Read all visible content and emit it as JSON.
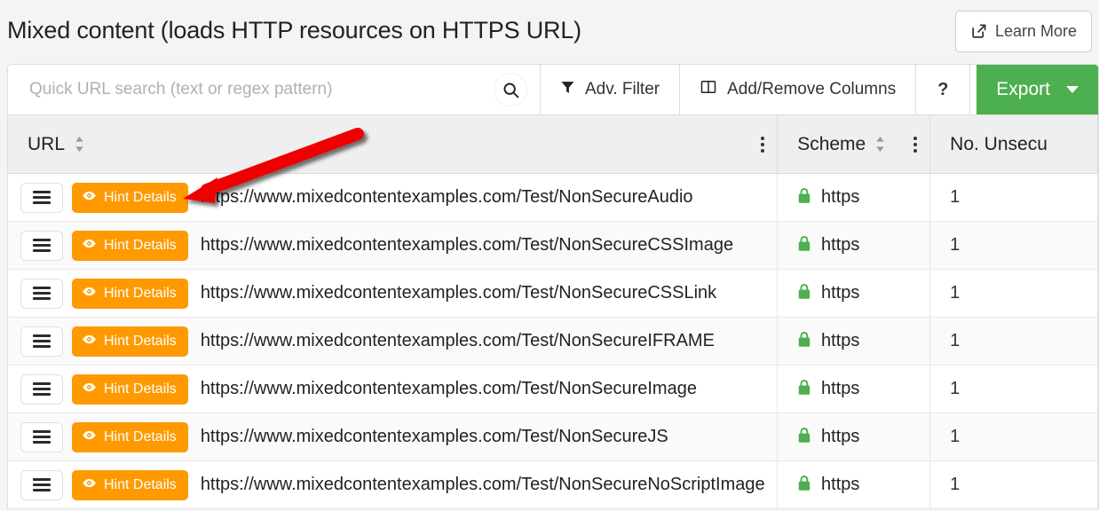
{
  "header": {
    "title": "Mixed content (loads HTTP resources on HTTPS URL)",
    "learn_more_label": "Learn More",
    "learn_more_icon": "external-link-icon"
  },
  "toolbar": {
    "search_placeholder": "Quick URL search (text or regex pattern)",
    "search_value": "",
    "search_icon": "search-icon",
    "adv_filter_label": "Adv. Filter",
    "adv_filter_icon": "funnel-icon",
    "add_remove_columns_label": "Add/Remove Columns",
    "add_remove_columns_icon": "columns-icon",
    "help_label": "?",
    "export_label": "Export",
    "export_caret_icon": "chevron-down-icon",
    "export_color": "#4caf50"
  },
  "table": {
    "columns": [
      {
        "label": "URL",
        "sortable": true,
        "has_menu": true
      },
      {
        "label": "Scheme",
        "sortable": true,
        "has_menu": true
      },
      {
        "label": "No. Unsecu",
        "sortable": false,
        "has_menu": false
      }
    ],
    "row_action": {
      "menu_icon": "hamburger-icon",
      "hint_label": "Hint Details",
      "hint_icon": "eye-icon",
      "hint_color": "#ff9900"
    },
    "scheme_icon": "lock-icon",
    "scheme_icon_color": "#4caf50",
    "rows": [
      {
        "url": "https://www.mixedcontentexamples.com/Test/NonSecureAudio",
        "scheme": "https",
        "count": "1"
      },
      {
        "url": "https://www.mixedcontentexamples.com/Test/NonSecureCSSImage",
        "scheme": "https",
        "count": "1"
      },
      {
        "url": "https://www.mixedcontentexamples.com/Test/NonSecureCSSLink",
        "scheme": "https",
        "count": "1"
      },
      {
        "url": "https://www.mixedcontentexamples.com/Test/NonSecureIFRAME",
        "scheme": "https",
        "count": "1"
      },
      {
        "url": "https://www.mixedcontentexamples.com/Test/NonSecureImage",
        "scheme": "https",
        "count": "1"
      },
      {
        "url": "https://www.mixedcontentexamples.com/Test/NonSecureJS",
        "scheme": "https",
        "count": "1"
      },
      {
        "url": "https://www.mixedcontentexamples.com/Test/NonSecureNoScriptImage",
        "scheme": "https",
        "count": "1"
      }
    ]
  },
  "annotation": {
    "arrow_color": "#ee0000",
    "arrow_points_to": "hint-details-button-row-1"
  }
}
